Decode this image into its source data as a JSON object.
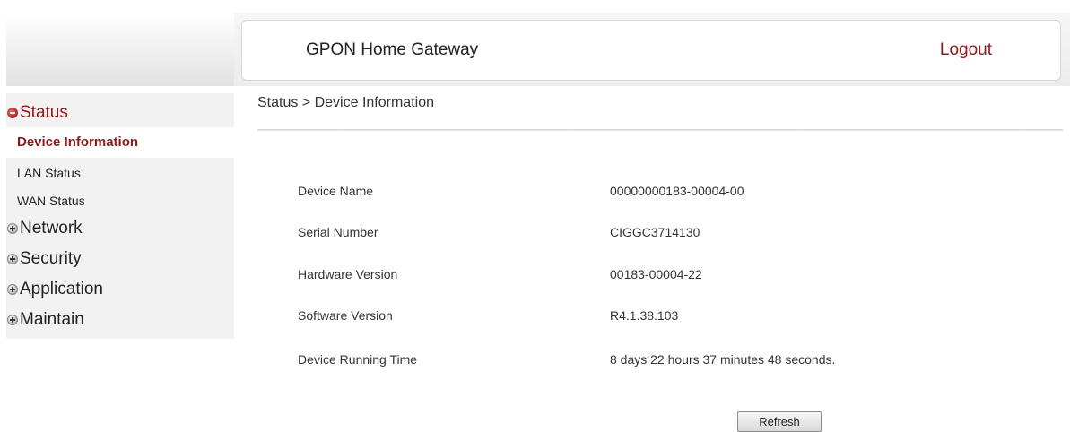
{
  "header": {
    "title": "GPON Home Gateway",
    "logout_label": "Logout"
  },
  "sidebar": {
    "groups": [
      {
        "label": "Status",
        "expanded": true,
        "items": [
          {
            "label": "Device Information",
            "selected": true
          },
          {
            "label": "LAN Status"
          },
          {
            "label": "WAN Status"
          }
        ]
      },
      {
        "label": "Network",
        "expanded": false
      },
      {
        "label": "Security",
        "expanded": false
      },
      {
        "label": "Application",
        "expanded": false
      },
      {
        "label": "Maintain",
        "expanded": false
      }
    ]
  },
  "breadcrumb": "Status > Device Information",
  "device_info": {
    "rows": [
      {
        "label": "Device Name",
        "value": "00000000183-00004-00"
      },
      {
        "label": "Serial Number",
        "value": "CIGGC3714130"
      },
      {
        "label": "Hardware Version",
        "value": "00183-00004-22"
      },
      {
        "label": "Software Version",
        "value": "R4.1.38.103"
      },
      {
        "label": "Device Running Time",
        "value": "8 days 22 hours 37 minutes 48 seconds."
      }
    ]
  },
  "refresh_label": "Refresh",
  "colors": {
    "accent": "#8b1a1a",
    "sidebar_bg": "#f2f2f2"
  },
  "icons": {
    "expanded": "minus-circle-icon",
    "collapsed": "plus-circle-icon"
  }
}
